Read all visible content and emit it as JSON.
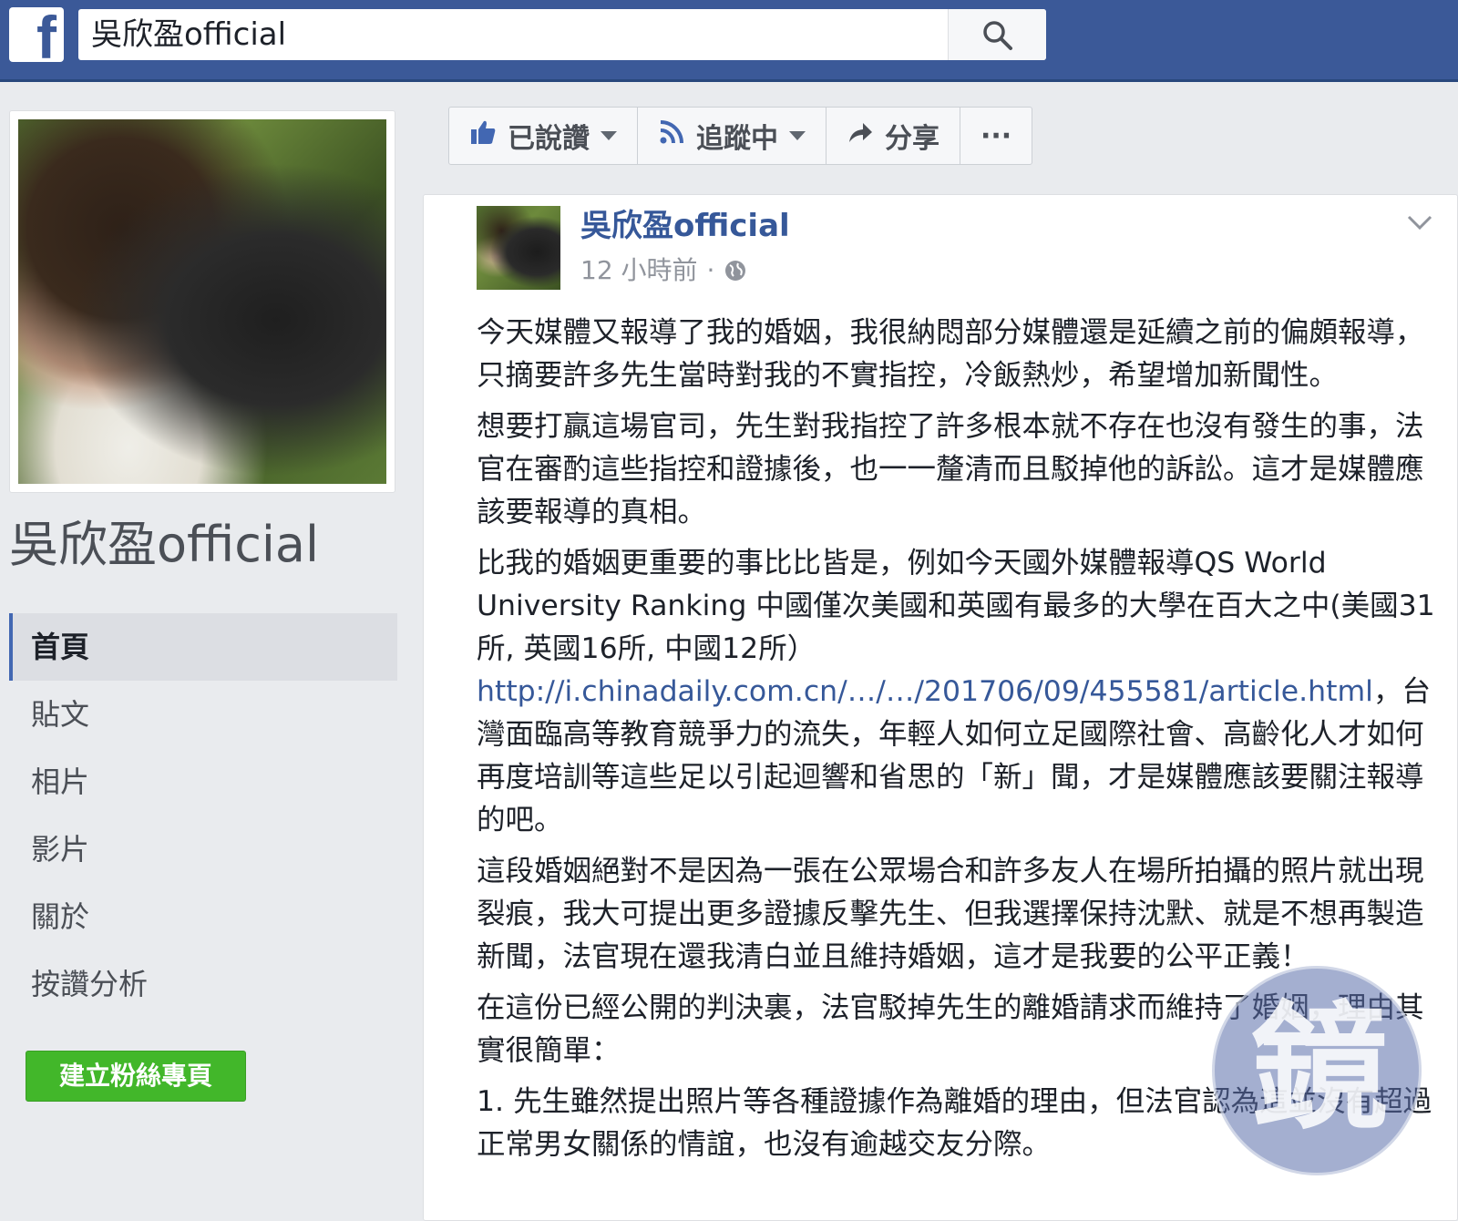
{
  "topbar": {
    "logo": "f",
    "search_value": "吳欣盈official"
  },
  "left": {
    "page_name": "吳欣盈official",
    "nav": [
      "首頁",
      "貼文",
      "相片",
      "影片",
      "關於",
      "按讚分析"
    ],
    "create_button": "建立粉絲專頁"
  },
  "actions": {
    "liked": "已說讚",
    "following": "追蹤中",
    "share": "分享",
    "more": "···"
  },
  "post": {
    "author": "吳欣盈official",
    "time": "12 小時前",
    "separator": "·",
    "p1": "今天媒體又報導了我的婚姻，我很納悶部分媒體還是延續之前的偏頗報導，只摘要許多先生當時對我的不實指控，冷飯熱炒，希望增加新聞性。",
    "p2": "想要打贏這場官司，先生對我指控了許多根本就不存在也沒有發生的事，法官在審酌這些指控和證據後，也一一釐清而且駁掉他的訴訟。這才是媒體應該要報導的真相。",
    "p3_a": "比我的婚姻更重要的事比比皆是，例如今天國外媒體報導QS World University Ranking 中國僅次美國和英國有最多的大學在百大之中(美國31所, 英國16所, 中國12所）",
    "p3_link": "http://i.chinadaily.com.cn/…/…/201706/09/455581/article.html",
    "p3_b": "，台灣面臨高等教育競爭力的流失，年輕人如何立足國際社會、高齡化人才如何再度培訓等這些足以引起迴響和省思的「新」聞，才是媒體應該要關注報導的吧。",
    "p4": "這段婚姻絕對不是因為一張在公眾場合和許多友人在場所拍攝的照片就出現裂痕，我大可提出更多證據反擊先生、但我選擇保持沈默、就是不想再製造新聞，法官現在還我清白並且維持婚姻，這才是我要的公平正義！",
    "p5": "在這份已經公開的判決裏，法官駁掉先生的離婚請求而維持了婚姻，理由其實很簡單：",
    "p6": "1. 先生雖然提出照片等各種證據作為離婚的理由，但法官認為這並沒有超過正常男女關係的情誼，也沒有逾越交友分際。"
  },
  "watermark": {
    "text": "鏡"
  }
}
